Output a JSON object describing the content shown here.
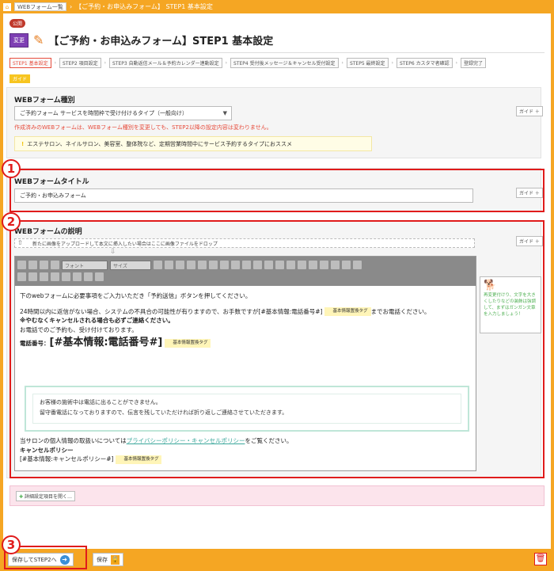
{
  "topbar": {
    "crumb1": "WEBフォーム一覧",
    "crumb2": "【ご予約・お申込みフォーム】 STEP1 基本設定"
  },
  "header": {
    "status_badge": "公開",
    "change_label": "変更",
    "title": "【ご予約・お申込みフォーム】STEP1 基本設定"
  },
  "steps": [
    {
      "label": "STEP1 基本設定"
    },
    {
      "label": "STEP2 項目設定"
    },
    {
      "label": "STEP3 自動返信メール＆予約カレンダー連動設定"
    },
    {
      "label": "STEP4 受付後メッセージ＆キャンセル受付設定"
    },
    {
      "label": "STEP5 最終設定"
    },
    {
      "label": "STEP6 カスタマ者確認"
    },
    {
      "label": "登録完了"
    }
  ],
  "guide_label": "ガイド",
  "guide_btn_label": "ガイド ＋",
  "form_type": {
    "title": "WEBフォーム種別",
    "selected": "ご予約フォーム サービスを時間枠で受け付けるタイプ（一般向け）",
    "warning": "作成済みのWEBフォームは、WEBフォーム種別を変更しても、STEP2以降の設定内容は変わりません。",
    "info": "エステサロン、ネイルサロン、美容室、整体院など、定期営業時間中にサービス予約するタイプにおススメ"
  },
  "form_title": {
    "title": "WEBフォームタイトル",
    "value": "ご予約・お申込みフォーム"
  },
  "form_desc": {
    "title": "WEBフォームの説明",
    "dropzone": "新たに画像をアップロードして本文に挿入したい場合はここに画像ファイルをドロップ",
    "font_select": "フォント",
    "size_select": "サイズ",
    "line1": "下のwebフォームに必要事項をご入力いただき「予約送信」ボタンを押してください。",
    "line2": "24時間以内に返信がない場合、システムの不具合の可能性が有りますので、お手数ですが",
    "var_phone": "[#基本情報:電話番号#]",
    "line2_tail": "までお電話ください。",
    "line3": "※やむなくキャンセルされる場合も必ずご連絡ください。",
    "line4": "お電話でのご予約も、受け付けております。",
    "phone_label": "電話番号：",
    "tag_label": "基本情報置換タグ",
    "box_line1": "お客様の施術中は電話に出ることができません。",
    "box_line2": "留守番電話になっておりますので、伝言を残していただければ折り返しご連絡させていただきます。",
    "policy_pre": "当サロンの個人情報の取扱いについては",
    "policy_link": "プライバシーポリシー・キャンセルポリシー",
    "policy_post": "をご覧ください。",
    "cancel_title": "キャンセルポリシー",
    "cancel_var": "[#基本情報:キャンセルポリシー#]"
  },
  "side_note": "再変更付けり、文字を大きくしたりなどの装飾は強調して、まずはガンガン文章を入力しましょう！",
  "detail_btn": "詳細設定項目を開く…",
  "bottom": {
    "next_label": "保存してSTEP2へ",
    "save_label": "保存"
  },
  "annotations": [
    "1",
    "2",
    "3"
  ],
  "colors": {
    "accent_orange": "#f5a623",
    "annotation_red": "#e01b1b",
    "change_purple": "#7e3fb3",
    "warning_red": "#e74c3c"
  }
}
